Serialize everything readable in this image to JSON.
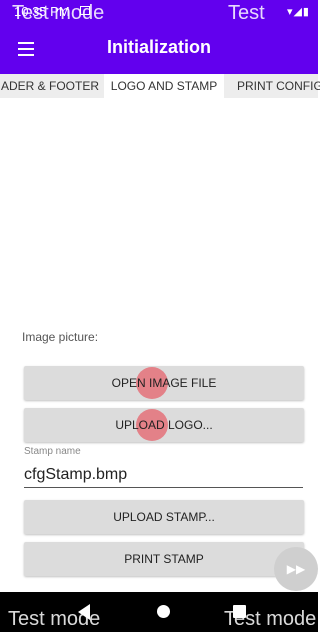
{
  "status": {
    "time": "10:35 PM",
    "icons": "▾◢▮"
  },
  "watermark": "Test mode",
  "appbar": {
    "title": "Initialization"
  },
  "tabs": [
    {
      "label": "ADER & FOOTER"
    },
    {
      "label": "LOGO AND STAMP",
      "active": true
    },
    {
      "label": "PRINT CONFIG"
    }
  ],
  "image_label": "Image picture:",
  "buttons": {
    "open_image": "OPEN IMAGE FILE",
    "upload_logo": "UPLOAD LOGO...",
    "upload_stamp": "UPLOAD STAMP...",
    "print_stamp": "PRINT STAMP"
  },
  "stamp": {
    "label": "Stamp name",
    "value": "cfgStamp.bmp"
  },
  "fab_icon": "fast-forward-icon",
  "colors": {
    "primary": "#6200ee",
    "button": "#dcdcdc",
    "ripple": "#e65a64"
  }
}
